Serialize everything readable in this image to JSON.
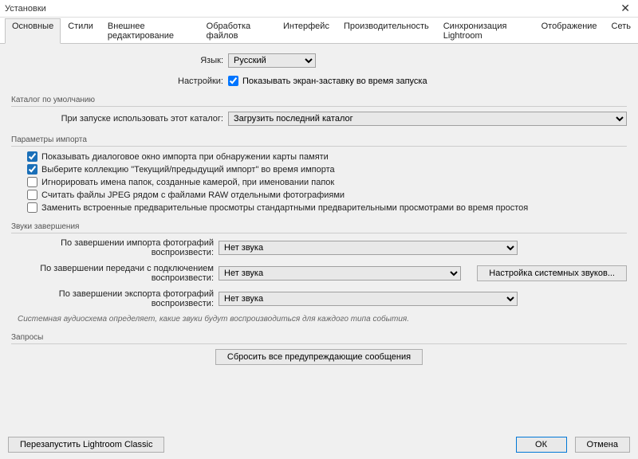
{
  "window": {
    "title": "Установки"
  },
  "tabs": [
    "Основные",
    "Стили",
    "Внешнее редактирование",
    "Обработка файлов",
    "Интерфейс",
    "Производительность",
    "Синхронизация Lightroom",
    "Отображение",
    "Сеть"
  ],
  "lang": {
    "label": "Язык:",
    "value": "Русский"
  },
  "settings": {
    "label": "Настройки:",
    "splash": "Показывать экран-заставку во время запуска"
  },
  "catalog": {
    "group": "Каталог по умолчанию",
    "label": "При запуске использовать этот каталог:",
    "value": "Загрузить последний каталог"
  },
  "import": {
    "group": "Параметры импорта",
    "c1": "Показывать диалоговое окно импорта при обнаружении карты памяти",
    "c2": "Выберите коллекцию \"Текущий/предыдущий импорт\" во время импорта",
    "c3": "Игнорировать имена папок, созданные камерой, при именовании папок",
    "c4": "Считать файлы JPEG рядом с файлами RAW отдельными фотографиями",
    "c5": "Заменить встроенные предварительные просмотры стандартными предварительными просмотрами во время простоя"
  },
  "sounds": {
    "group": "Звуки завершения",
    "r1": "По завершении импорта фотографий воспроизвести:",
    "r2": "По завершении передачи с подключением воспроизвести:",
    "r3": "По завершении экспорта фотографий воспроизвести:",
    "none": "Нет звука",
    "sysbtn": "Настройка системных звуков...",
    "note": "Системная аудиосхема определяет, какие звуки будут воспроизводиться для каждого типа события."
  },
  "prompts": {
    "group": "Запросы",
    "reset": "Сбросить все предупреждающие сообщения"
  },
  "footer": {
    "restart": "Перезапустить Lightroom Classic",
    "ok": "ОК",
    "cancel": "Отмена"
  }
}
